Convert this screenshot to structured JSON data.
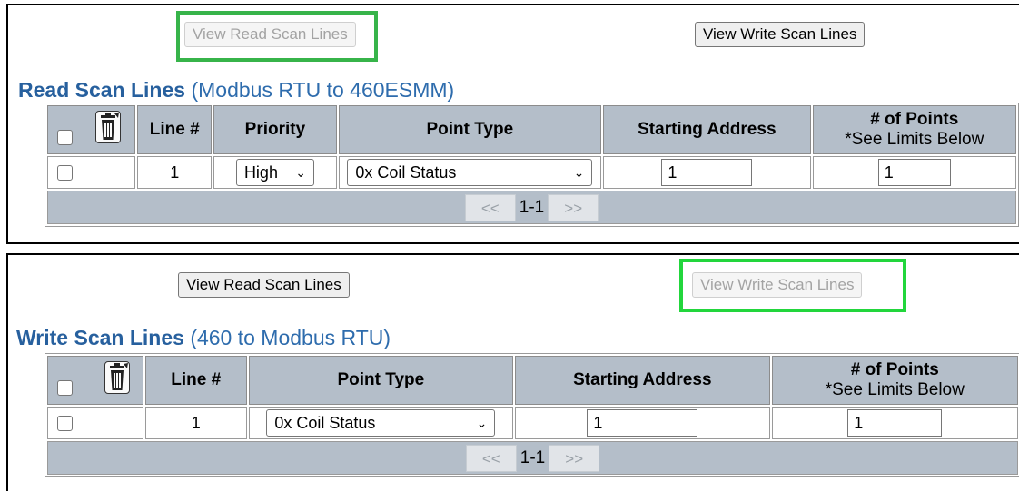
{
  "read_panel": {
    "view_read_btn": "View Read Scan Lines",
    "view_write_btn": "View Write Scan Lines",
    "heading_bold": "Read Scan Lines",
    "heading_rest": "(Modbus RTU to 460ESMM)",
    "columns": {
      "line": "Line #",
      "priority": "Priority",
      "point_type": "Point Type",
      "start": "Starting Address",
      "points": "# of Points",
      "points_sub": "*See Limits Below"
    },
    "row": {
      "line": "1",
      "priority": "High",
      "point_type": "0x Coil Status",
      "start": "1",
      "points": "1"
    },
    "pager": {
      "prev": "<<",
      "range": "1-1",
      "next": ">>"
    }
  },
  "write_panel": {
    "view_read_btn": "View Read Scan Lines",
    "view_write_btn": "View Write Scan Lines",
    "heading_bold": "Write Scan Lines",
    "heading_rest": "(460 to Modbus RTU)",
    "columns": {
      "line": "Line #",
      "point_type": "Point Type",
      "start": "Starting Address",
      "points": "# of Points",
      "points_sub": "*See Limits Below"
    },
    "row": {
      "line": "1",
      "point_type": "0x Coil Status",
      "start": "1",
      "points": "1"
    },
    "pager": {
      "prev": "<<",
      "range": "1-1",
      "next": ">>"
    }
  },
  "icons": [
    "trash-icon",
    "chevron-down-icon",
    "checkbox"
  ],
  "colors": {
    "heading": "#2e6cad",
    "header_bg": "#b4bec9",
    "highlight_read": "#37b44a",
    "highlight_write": "#22d63c"
  }
}
